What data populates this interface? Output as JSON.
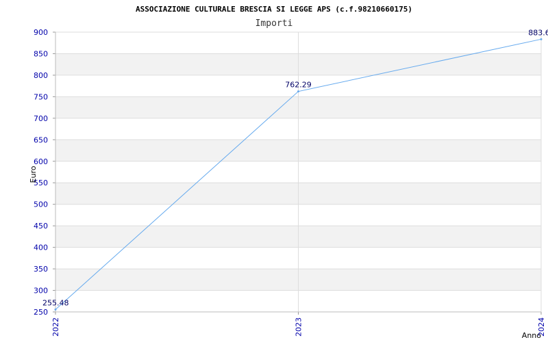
{
  "chart_data": {
    "type": "line",
    "title": "ASSOCIAZIONE CULTURALE BRESCIA SI LEGGE APS (c.f.98210660175)",
    "subtitle": "Importi",
    "xlabel": "Anno",
    "ylabel": "Euro",
    "categories": [
      "2022",
      "2023",
      "2024"
    ],
    "series": [
      {
        "values": [
          255.48,
          762.29,
          883.6
        ],
        "labels": [
          "255.48",
          "762.29",
          "883.6"
        ]
      }
    ],
    "ylim": [
      250,
      900
    ],
    "yticks": [
      250,
      300,
      350,
      400,
      450,
      500,
      550,
      600,
      650,
      700,
      750,
      800,
      850,
      900
    ],
    "grid": true,
    "colors": {
      "line": "#66aaee",
      "band_alt": "#f2f2f2",
      "grid": "#dddddd",
      "tick_text": "#0000aa",
      "data_text": "#000066"
    }
  }
}
